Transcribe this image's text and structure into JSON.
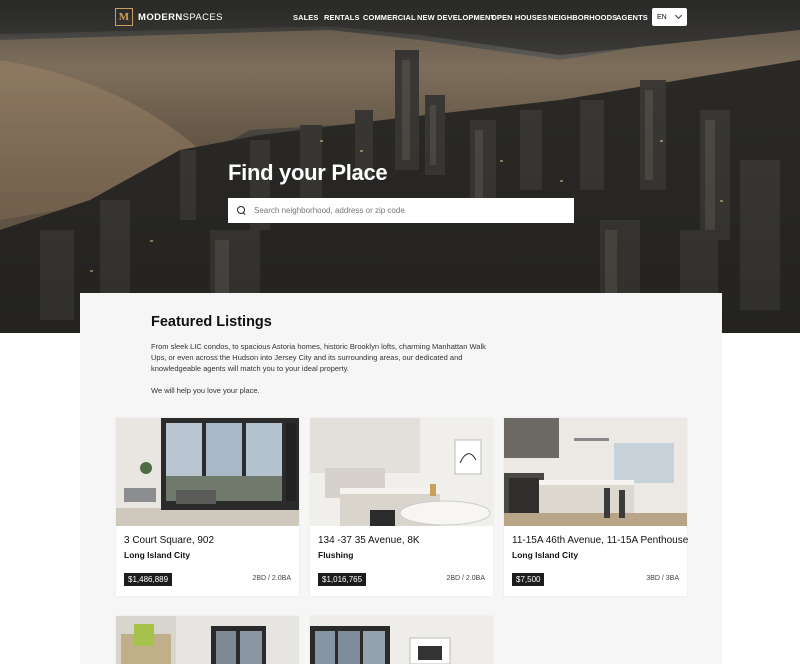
{
  "brand": {
    "mark": "M",
    "name_bold": "MODERN",
    "name_light": "SPACES"
  },
  "nav": {
    "items": [
      "SALES",
      "RENTALS",
      "COMMERCIAL",
      "NEW DEVELOPMENT",
      "OPEN HOUSES",
      "NEIGHBORHOODS",
      "AGENTS"
    ],
    "language": "EN"
  },
  "hero": {
    "title": "Find your Place",
    "search_placeholder": "Search neighborhood, address or zip code"
  },
  "featured": {
    "title": "Featured Listings",
    "intro": "From sleek LIC condos, to spacious Astoria homes, historic Brooklyn lofts, charming Manhattan Walk Ups, or even across the Hudson into Jersey City and its surrounding areas, our dedicated and knowledgeable agents will match you to your ideal property.",
    "tagline": "We will help you love your place."
  },
  "listings": [
    {
      "address": "3 Court Square, 902",
      "neighborhood": "Long Island City",
      "price": "$1,486,889",
      "beds_baths": "2BD / 2.0BA"
    },
    {
      "address": "134 -37 35 Avenue, 8K",
      "neighborhood": "Flushing",
      "price": "$1,016,765",
      "beds_baths": "2BD / 2.0BA"
    },
    {
      "address": "11-15A 46th Avenue, 11-15A Penthouse",
      "neighborhood": "Long Island City",
      "price": "$7,500",
      "beds_baths": "3BD / 3BA"
    }
  ],
  "colors": {
    "accent_gold": "#c9a15a",
    "panel_bg": "#f6f6f6",
    "price_badge": "#1c1c1c"
  },
  "icons": {
    "search": "search-icon",
    "language_dropdown": "chevron-down-icon",
    "logo": "logo-icon"
  }
}
